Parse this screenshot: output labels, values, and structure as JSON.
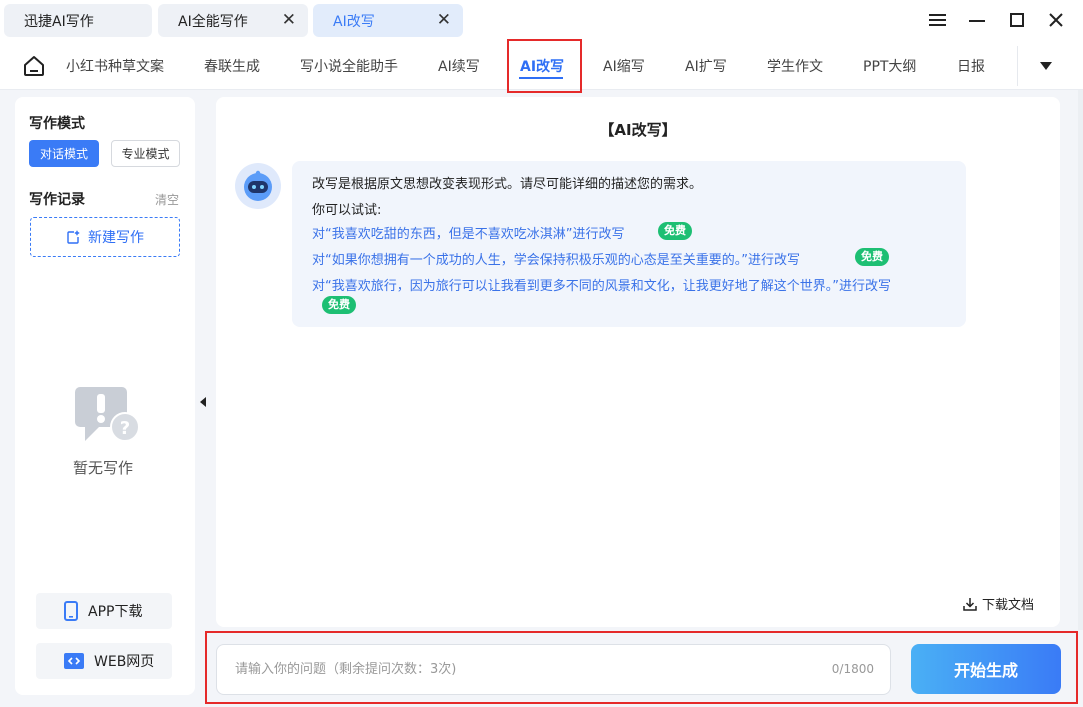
{
  "window": {
    "tabs": [
      {
        "label": "迅捷AI写作",
        "closable": false
      },
      {
        "label": "AI全能写作",
        "closable": true
      },
      {
        "label": "AI改写",
        "closable": true,
        "active": true
      }
    ],
    "close_glyph": "✕",
    "controls": [
      "menu-icon",
      "minimize-icon",
      "maximize-icon",
      "close-icon"
    ]
  },
  "nav": {
    "items": [
      "小红书种草文案",
      "春联生成",
      "写小说全能助手",
      "AI续写",
      "AI改写",
      "AI缩写",
      "AI扩写",
      "学生作文",
      "PPT大纲",
      "日报"
    ],
    "active": "AI改写",
    "accent": "#2f6ff5",
    "highlight": "#e52a2a"
  },
  "sidebar": {
    "mode_title": "写作模式",
    "modes": [
      "对话模式",
      "专业模式"
    ],
    "active_mode": "对话模式",
    "records_title": "写作记录",
    "clear_label": "清空",
    "new_label": "新建写作",
    "empty_text": "暂无写作",
    "app_download": "APP下载",
    "web_page": "WEB网页"
  },
  "main": {
    "title": "【AI改写】",
    "intro": "改写是根据原文思想改变表现形式。请尽可能详细的描述您的需求。",
    "try_label": "你可以试试:",
    "examples": [
      "对“我喜欢吃甜的东西，但是不喜欢吃冰淇淋”进行改写",
      "对“如果你想拥有一个成功的人生，学会保持积极乐观的心态是至关重要的。”进行改写",
      "对“我喜欢旅行，因为旅行可以让我看到更多不同的风景和文化，让我更好地了解这个世界。”进行改写"
    ],
    "free_badge": "免费",
    "download_label": "下载文档"
  },
  "input": {
    "placeholder": "请输入你的问题（剩余提问次数：3次)",
    "value": "",
    "counter": "0/1800",
    "submit_label": "开始生成"
  }
}
